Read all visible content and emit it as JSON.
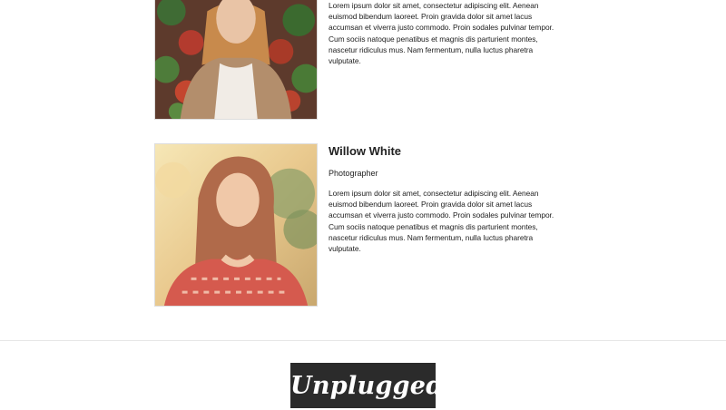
{
  "team": [
    {
      "photo_icon": "portrait-woman-beanie-photo",
      "bio": "Lorem ipsum dolor sit amet, consectetur adipiscing elit. Aenean euismod bibendum laoreet. Proin gravida dolor sit amet lacus accumsan et viverra justo commodo. Proin sodales pulvinar tempor. Cum sociis natoque penatibus et magnis dis parturient montes, nascetur ridiculus mus. Nam fermentum, nulla luctus pharetra vulputate."
    },
    {
      "photo_icon": "portrait-woman-red-top-photo",
      "name": "Willow White",
      "role": "Photographer",
      "bio": "Lorem ipsum dolor sit amet, consectetur adipiscing elit. Aenean euismod bibendum laoreet. Proin gravida dolor sit amet lacus accumsan et viverra justo commodo. Proin sodales pulvinar tempor. Cum sociis natoque penatibus et magnis dis parturient montes, nascetur ridiculus mus. Nam fermentum, nulla luctus pharetra vulputate."
    }
  ],
  "footer": {
    "logo_text": "Unplugged"
  },
  "colors": {
    "logo_background": "#2b2b2b",
    "logo_text": "#ffffff",
    "text": "#222222",
    "divider": "#e6e6e6"
  }
}
